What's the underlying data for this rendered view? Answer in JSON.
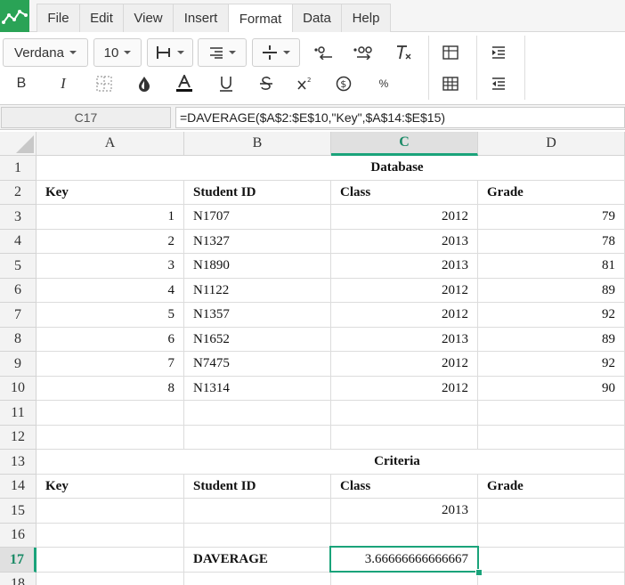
{
  "menu": {
    "items": [
      "File",
      "Edit",
      "View",
      "Insert",
      "Format",
      "Data",
      "Help"
    ],
    "active": "Format"
  },
  "toolbar": {
    "font_name": "Verdana",
    "font_size": "10",
    "bold": "B",
    "italic": "I",
    "percent": "%"
  },
  "formula": {
    "cell_ref": "C17",
    "content": "=DAVERAGE($A$2:$E$10,\"Key\",$A$14:$E$15)"
  },
  "columns": [
    "A",
    "B",
    "C",
    "D"
  ],
  "selected_column": "C",
  "selected_row": "17",
  "rows": [
    "1",
    "2",
    "3",
    "4",
    "5",
    "6",
    "7",
    "8",
    "9",
    "10",
    "11",
    "12",
    "13",
    "14",
    "15",
    "16",
    "17",
    "18"
  ],
  "cells": {
    "r1_title": "Database",
    "r2": [
      "Key",
      "Student ID",
      "Class",
      "Grade"
    ],
    "data": [
      [
        "1",
        "N1707",
        "2012",
        "79"
      ],
      [
        "2",
        "N1327",
        "2013",
        "78"
      ],
      [
        "3",
        "N1890",
        "2013",
        "81"
      ],
      [
        "4",
        "N1122",
        "2012",
        "89"
      ],
      [
        "5",
        "N1357",
        "2012",
        "92"
      ],
      [
        "6",
        "N1652",
        "2013",
        "89"
      ],
      [
        "7",
        "N7475",
        "2012",
        "92"
      ],
      [
        "8",
        "N1314",
        "2012",
        "90"
      ]
    ],
    "r13_title": "Criteria",
    "r14": [
      "Key",
      "Student ID",
      "Class",
      "Grade"
    ],
    "r15_class": "2013",
    "r17_label": "DAVERAGE",
    "r17_value": "3.66666666666667"
  },
  "colors": {
    "accent": "#1aa37a",
    "logo": "#2aa356"
  }
}
